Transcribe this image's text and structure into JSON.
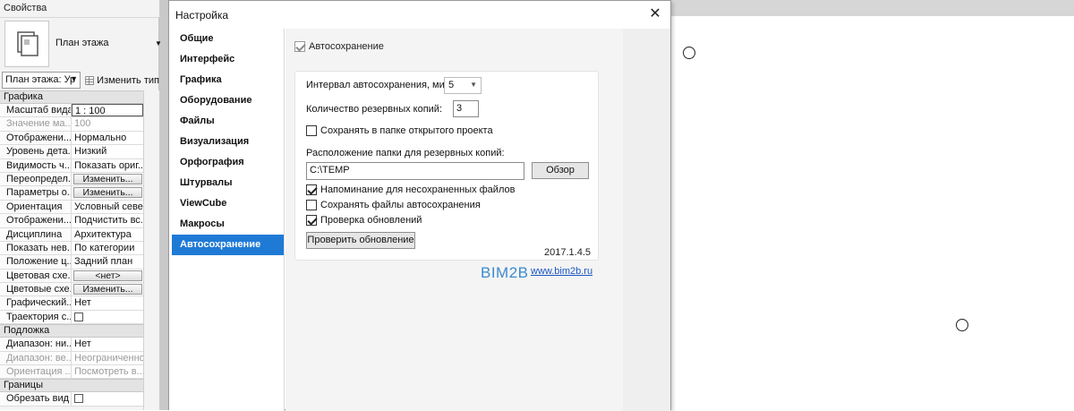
{
  "properties": {
    "title": "Свойства",
    "type_name": "План этажа",
    "instance_selector": "План этажа: Ур",
    "edit_type_label": "Изменить тип",
    "groups": [
      {
        "name": "Графика",
        "rows": [
          {
            "key": "Масштаб вида",
            "value": "1 : 100",
            "kind": "input"
          },
          {
            "key": "Значение ма...",
            "value": "100",
            "kind": "disabled"
          },
          {
            "key": "Отображени...",
            "value": "Нормально",
            "kind": "text"
          },
          {
            "key": "Уровень дета...",
            "value": "Низкий",
            "kind": "text"
          },
          {
            "key": "Видимость ч...",
            "value": "Показать ориг...",
            "kind": "text"
          },
          {
            "key": "Переопредел...",
            "value": "Изменить...",
            "kind": "button"
          },
          {
            "key": "Параметры о...",
            "value": "Изменить...",
            "kind": "button"
          },
          {
            "key": "Ориентация",
            "value": "Условный север",
            "kind": "text"
          },
          {
            "key": "Отображени...",
            "value": "Подчистить вс...",
            "kind": "text"
          },
          {
            "key": "Дисциплина",
            "value": "Архитектура",
            "kind": "text"
          },
          {
            "key": "Показать нев...",
            "value": "По категории",
            "kind": "text"
          },
          {
            "key": "Положение ц...",
            "value": "Задний план",
            "kind": "text"
          },
          {
            "key": "Цветовая схе...",
            "value": "<нет>",
            "kind": "button"
          },
          {
            "key": "Цветовые схе...",
            "value": "Изменить...",
            "kind": "button"
          },
          {
            "key": "Графический...",
            "value": "Нет",
            "kind": "text"
          },
          {
            "key": "Траектория с...",
            "value": "",
            "kind": "checkbox"
          }
        ]
      },
      {
        "name": "Подложка",
        "rows": [
          {
            "key": "Диапазон: ни...",
            "value": "Нет",
            "kind": "text"
          },
          {
            "key": "Диапазон: ве...",
            "value": "Неограниченно",
            "kind": "disabled"
          },
          {
            "key": "Ориентация ...",
            "value": "Посмотреть в...",
            "kind": "disabled"
          }
        ]
      },
      {
        "name": "Границы",
        "rows": [
          {
            "key": "Обрезать вид",
            "value": "",
            "kind": "checkbox"
          }
        ]
      }
    ]
  },
  "dialog": {
    "title": "Настройка",
    "close_glyph": "✕",
    "nav": [
      "Общие",
      "Интерфейс",
      "Графика",
      "Оборудование",
      "Файлы",
      "Визуализация",
      "Орфография",
      "Штурвалы",
      "ViewCube",
      "Макросы",
      "Автосохранение"
    ],
    "active_nav": "Автосохранение",
    "autosave": {
      "enable_label": "Автосохранение",
      "enabled": true,
      "interval_label": "Интервал автосохранения, мин:",
      "interval_value": "5",
      "backups_label": "Количество резервных копий:",
      "backups_value": "3",
      "save_in_project_folder_label": "Сохранять в папке открытого проекта",
      "save_in_project_folder": false,
      "folder_label": "Расположение папки для резервных копий:",
      "folder_value": "C:\\TEMP",
      "browse_label": "Обзор",
      "remind_unsaved_label": "Напоминание для несохраненных файлов",
      "remind_unsaved": true,
      "keep_autosave_files_label": "Сохранять файлы автосохранения",
      "keep_autosave_files": false,
      "check_updates_label": "Проверка обновлений",
      "check_updates": true,
      "check_update_button": "Проверить обновление",
      "version": "2017.1.4.5"
    },
    "branding": {
      "logo_text": "BIM2B",
      "link_text": "www.bim2b.ru"
    }
  },
  "colors": {
    "accent": "#1f7ad6",
    "link": "#1a56c4",
    "logo": "#3b8ad0"
  }
}
